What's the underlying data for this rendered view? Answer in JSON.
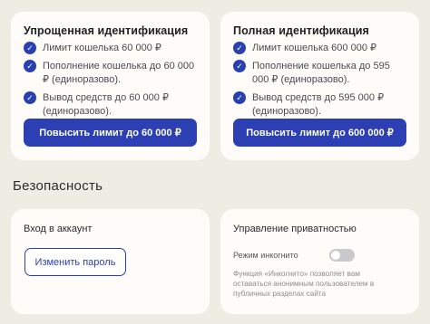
{
  "limits": {
    "simple": {
      "title": "Упрощенная идентификация",
      "items": [
        "Лимит кошелька 60 000 ₽",
        "Пополнение кошелька до 60 000 ₽ (единоразово).",
        "Вывод средств до 60 000 ₽ (единоразово)."
      ],
      "button": "Повысить лимит до 60 000 ₽"
    },
    "full": {
      "title": "Полная идентификация",
      "items": [
        "Лимит кошелька 600 000 ₽",
        "Пополнение кошелька до 595 000 ₽ (единоразово).",
        "Вывод средств до 595 000 ₽ (единоразово)."
      ],
      "button": "Повысить лимит до 600 000 ₽"
    }
  },
  "security": {
    "title": "Безопасность",
    "login": {
      "title": "Вход в аккаунт",
      "button": "Изменить пароль"
    },
    "privacy": {
      "title": "Управление приватностью",
      "incognito_label": "Режим инкогнито",
      "incognito_enabled": false,
      "hint": "Функция «Инкогнито» позволяет вам оставаться анонимным пользователем в публичных разделах сайта"
    }
  },
  "colors": {
    "accent": "#2c3fb3",
    "page_bg": "#efece4",
    "card_bg": "#fdfcf8"
  },
  "icons": {
    "check": "check-circle-icon"
  }
}
